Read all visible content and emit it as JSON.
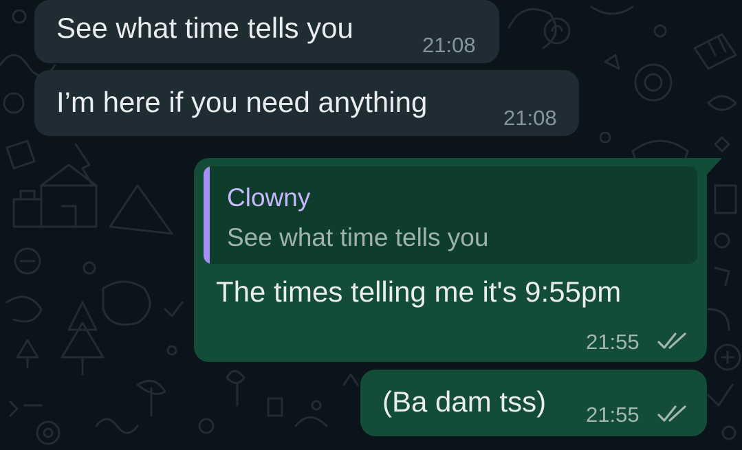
{
  "messages": [
    {
      "direction": "incoming",
      "text": "See what time tells you",
      "time": "21:08"
    },
    {
      "direction": "incoming",
      "text": "I’m here if you need anything",
      "time": "21:08"
    },
    {
      "direction": "outgoing",
      "text": "The times telling me it's 9:55pm",
      "time": "21:55",
      "status": "read",
      "reply_to": {
        "author": "Clowny",
        "text": "See what time tells you"
      }
    },
    {
      "direction": "outgoing",
      "text": "(Ba dam tss)",
      "time": "21:55",
      "status": "read"
    }
  ],
  "colors": {
    "background": "#0b141a",
    "incoming_bubble": "#1f2c34",
    "outgoing_bubble": "#134d37",
    "quote_accent": "#a58ff4"
  },
  "icons": [
    "double-check-icon"
  ]
}
